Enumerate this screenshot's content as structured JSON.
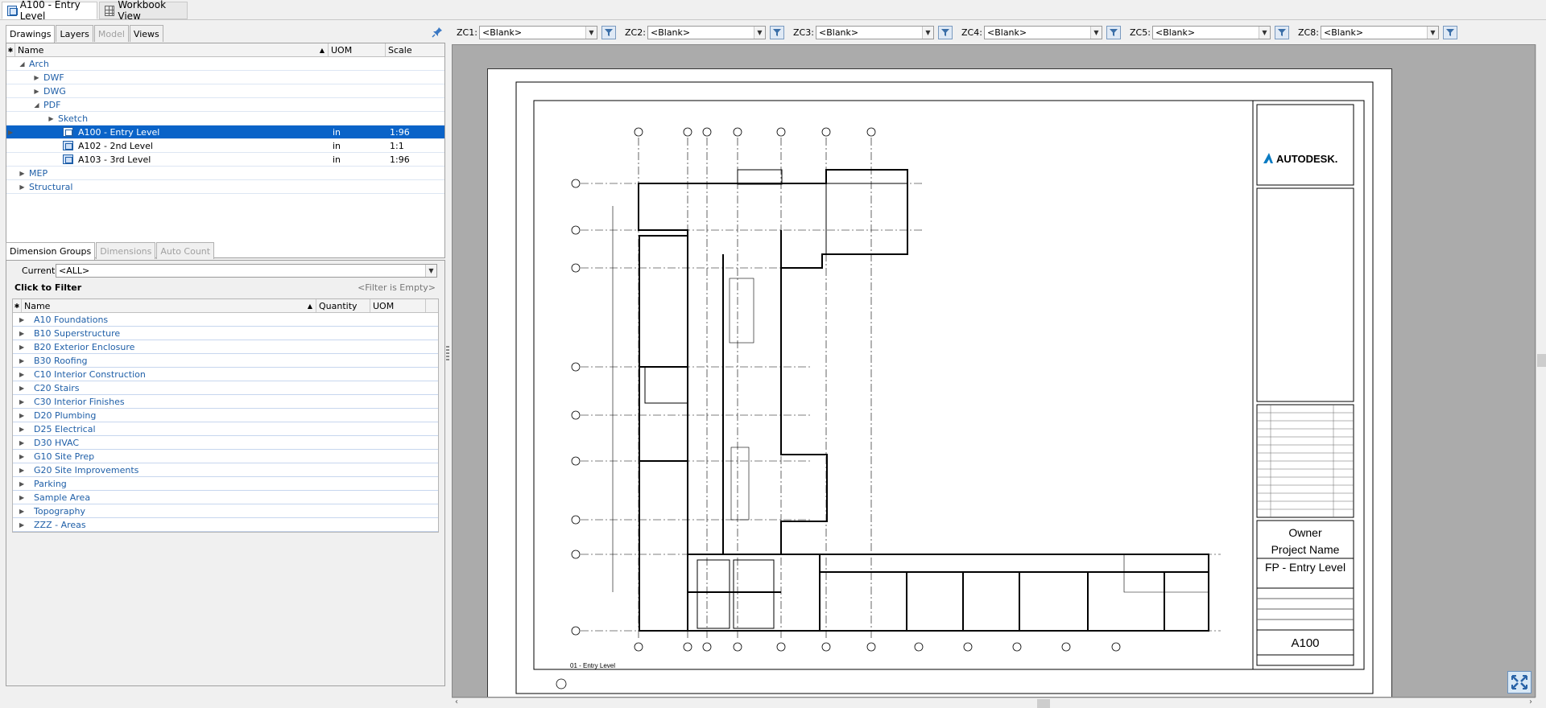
{
  "doc_tabs": [
    {
      "label": "A100 - Entry Level"
    },
    {
      "label": "Workbook View"
    }
  ],
  "drawings_panel": {
    "tabs": [
      "Drawings",
      "Layers",
      "Model",
      "Views"
    ],
    "columns": [
      "Name",
      "UOM",
      "Scale"
    ],
    "tree": [
      {
        "label": "Arch"
      },
      {
        "label": "DWF"
      },
      {
        "label": "DWG"
      },
      {
        "label": "PDF"
      },
      {
        "label": "Sketch"
      },
      {
        "label": "A100 - Entry Level",
        "uom": "in",
        "scale": "1:96"
      },
      {
        "label": "A102 - 2nd Level",
        "uom": "in",
        "scale": "1:1"
      },
      {
        "label": "A103 - 3rd Level",
        "uom": "in",
        "scale": "1:96"
      },
      {
        "label": "MEP"
      },
      {
        "label": "Structural"
      }
    ]
  },
  "dimension_panel": {
    "tabs": [
      "Dimension Groups",
      "Dimensions",
      "Auto Count"
    ],
    "current_label": "Current:",
    "current_value": "<ALL>",
    "filter_label": "Click to Filter",
    "filter_status": "<Filter is Empty>",
    "columns": [
      "Name",
      "Quantity",
      "UOM"
    ],
    "groups": [
      "A10 Foundations",
      "B10 Superstructure",
      "B20 Exterior Enclosure",
      "B30 Roofing",
      "C10 Interior Construction",
      "C20 Stairs",
      "C30 Interior Finishes",
      "D20 Plumbing",
      "D25 Electrical",
      "D30 HVAC",
      "G10 Site Prep",
      "G20 Site Improvements",
      "Parking",
      "Sample Area",
      "Topography",
      "ZZZ - Areas"
    ]
  },
  "zones": [
    {
      "label": "ZC1:",
      "value": "<Blank>"
    },
    {
      "label": "ZC2:",
      "value": "<Blank>"
    },
    {
      "label": "ZC3:",
      "value": "<Blank>"
    },
    {
      "label": "ZC4:",
      "value": "<Blank>"
    },
    {
      "label": "ZC5:",
      "value": "<Blank>"
    },
    {
      "label": "ZC8:",
      "value": "<Blank>"
    }
  ],
  "title_block": {
    "logo": "AUTODESK.",
    "owner": "Owner",
    "project": "Project Name",
    "sheet_name": "FP - Entry Level",
    "sheet_number": "A100",
    "level_tag": "01 - Entry Level"
  },
  "colors": {
    "accent": "#0a63c8",
    "link": "#1f5fa8"
  }
}
